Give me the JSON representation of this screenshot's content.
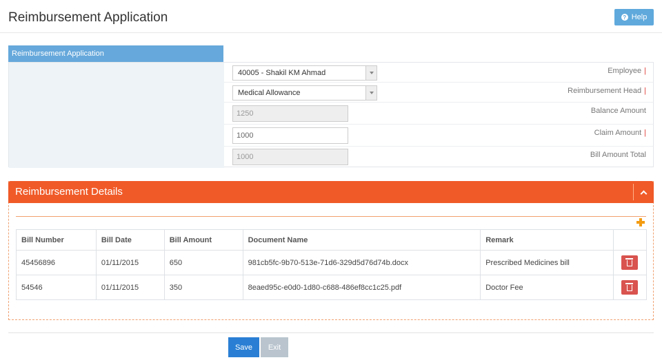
{
  "page": {
    "title": "Reimbursement Application",
    "help_label": "Help"
  },
  "form": {
    "tab_label": "Reimbursement Application",
    "employee": {
      "label": "Employee",
      "value": "40005 - Shakil KM Ahmad"
    },
    "head": {
      "label": "Reimbursement Head",
      "value": "Medical Allowance"
    },
    "balance": {
      "label": "Balance Amount",
      "value": "1250"
    },
    "claim": {
      "label": "Claim Amount",
      "value": "1000"
    },
    "bill_total": {
      "label": "Bill Amount Total",
      "value": "1000"
    },
    "required_marker": "|"
  },
  "details": {
    "title": "Reimbursement Details",
    "columns": [
      "Bill Number",
      "Bill Date",
      "Bill Amount",
      "Document Name",
      "Remark"
    ],
    "rows": [
      {
        "bill_number": "45456896",
        "bill_date": "01/11/2015",
        "bill_amount": "650",
        "document": "981cb5fc-9b70-513e-71d6-329d5d76d74b.docx",
        "remark": "Prescribed Medicines bill"
      },
      {
        "bill_number": "54546",
        "bill_date": "01/11/2015",
        "bill_amount": "350",
        "document": "8eaed95c-e0d0-1d80-c688-486ef8cc1c25.pdf",
        "remark": "Doctor Fee"
      }
    ]
  },
  "actions": {
    "save": "Save",
    "exit": "Exit"
  },
  "colors": {
    "panel_header": "#f05a28",
    "tab": "#66a8db",
    "save": "#2a7fd4",
    "delete": "#d9534f",
    "required": "#e0403a"
  }
}
